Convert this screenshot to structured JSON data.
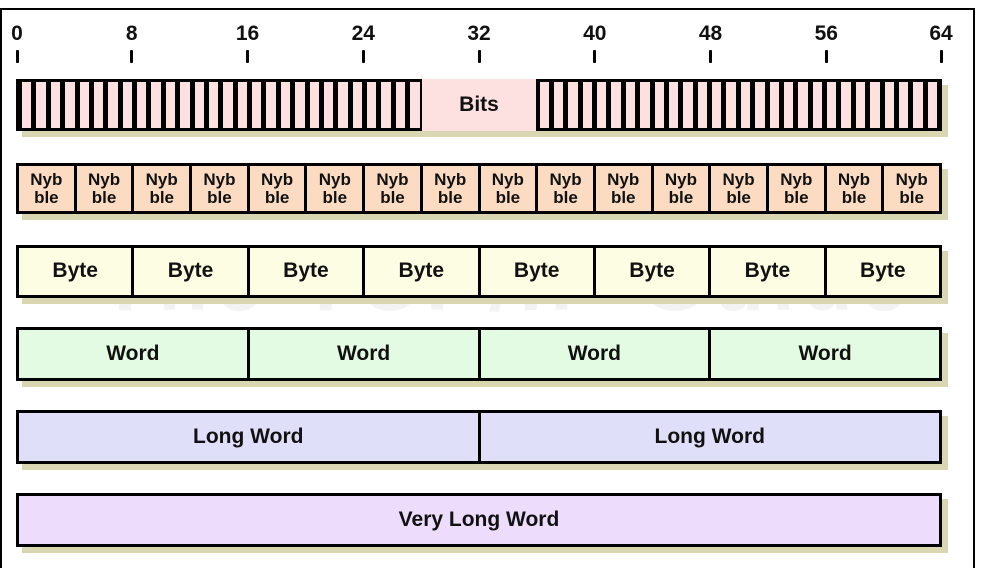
{
  "diagram": {
    "watermark": "The TCP/IP Guide",
    "scale": {
      "total_bits": 64,
      "ticks": [
        "0",
        "8",
        "16",
        "24",
        "32",
        "40",
        "48",
        "56",
        "64"
      ]
    },
    "rows": [
      {
        "id": "bits",
        "label": "Bits",
        "count": 64,
        "bits_each": 1,
        "color": "#fde0e0"
      },
      {
        "id": "nybble",
        "label_line1": "Nyb",
        "label_line2": "ble",
        "count": 16,
        "bits_each": 4,
        "color": "#fbdcc2"
      },
      {
        "id": "byte",
        "label": "Byte",
        "count": 8,
        "bits_each": 8,
        "color": "#fdfde3"
      },
      {
        "id": "word",
        "label": "Word",
        "count": 4,
        "bits_each": 16,
        "color": "#e2fbe2"
      },
      {
        "id": "long-word",
        "label": "Long Word",
        "count": 2,
        "bits_each": 32,
        "color": "#dfdffa"
      },
      {
        "id": "very-long-word",
        "label": "Very Long Word",
        "count": 1,
        "bits_each": 64,
        "color": "#eedcfc"
      }
    ],
    "shadow_color": "#d9d6b2",
    "border_color": "#000000"
  }
}
